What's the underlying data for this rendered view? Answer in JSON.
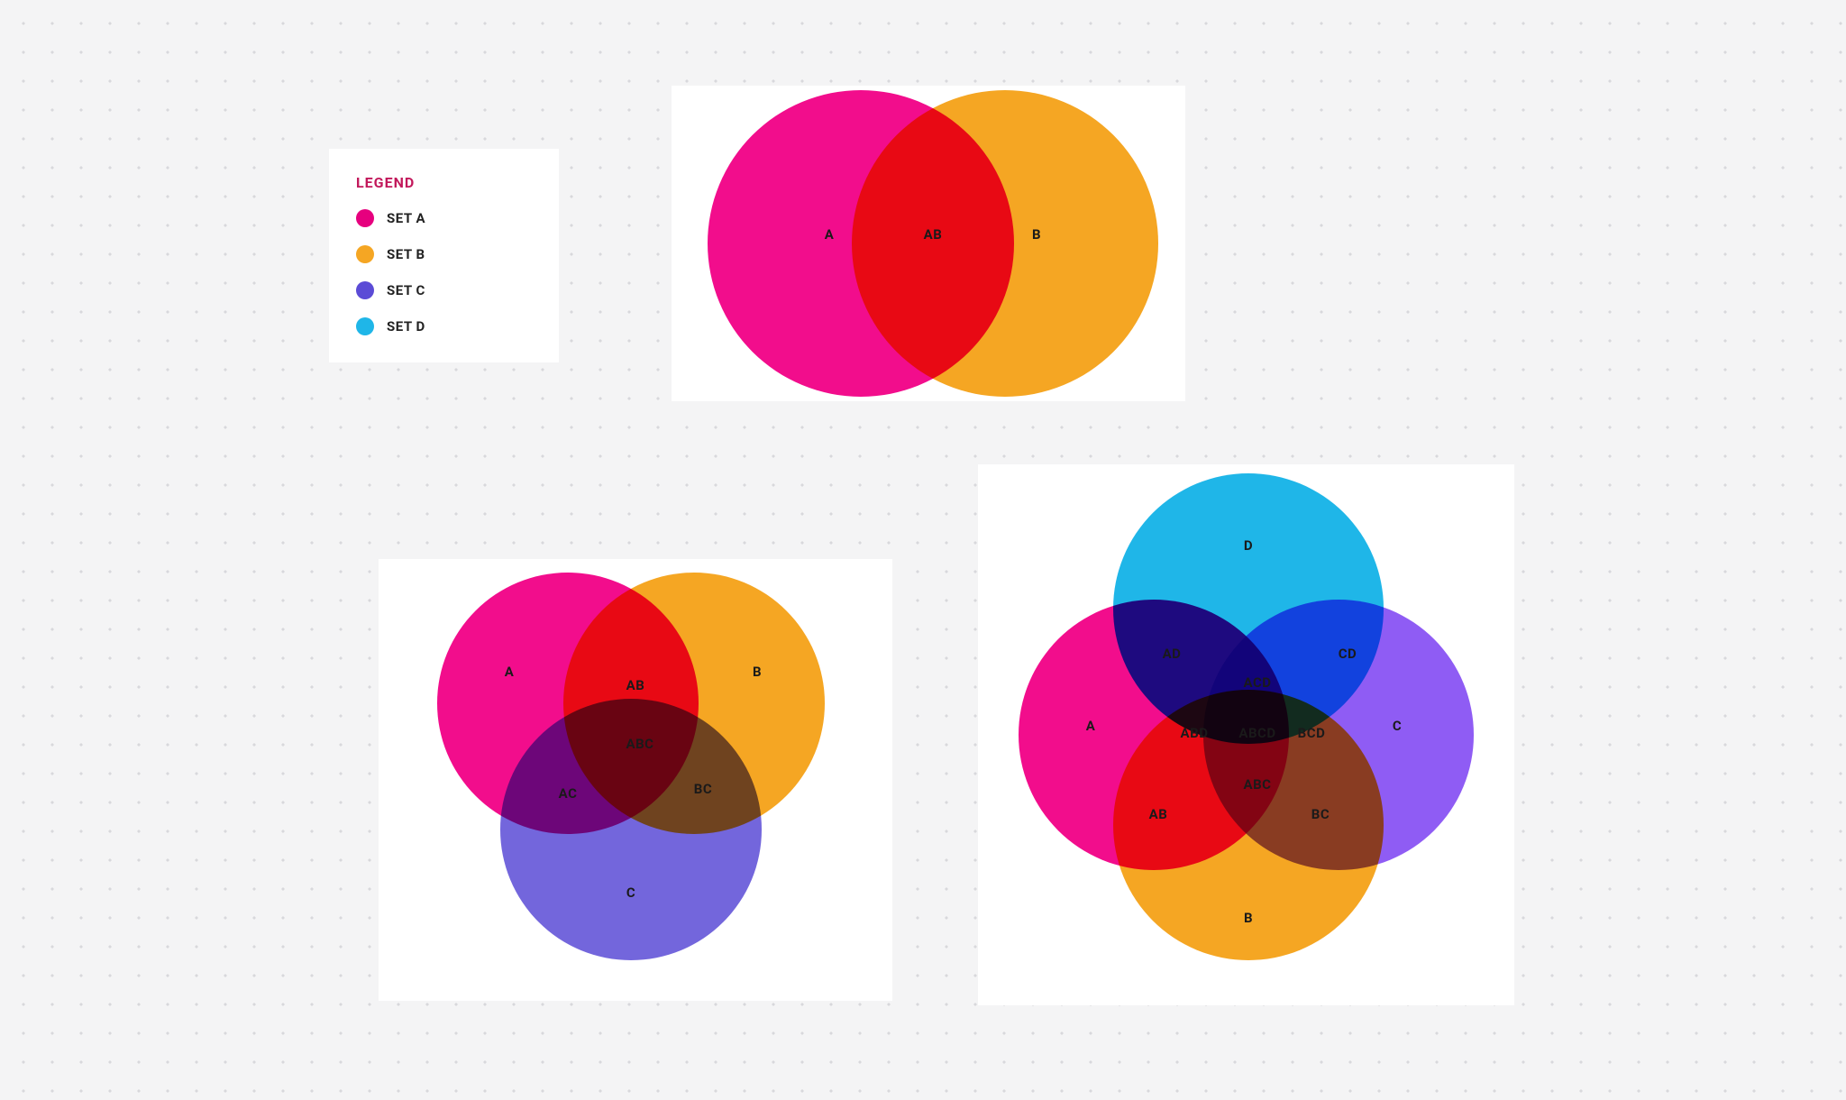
{
  "legend": {
    "title": "LEGEND",
    "items": [
      {
        "label": "SET A",
        "color": "#e6007e"
      },
      {
        "label": "SET B",
        "color": "#f5a623"
      },
      {
        "label": "SET C",
        "color": "#5b4bd6"
      },
      {
        "label": "SET D",
        "color": "#1fb6e8"
      }
    ]
  },
  "colors": {
    "A": "#f20d8c",
    "B": "#f5a623",
    "C": "#5b4bd6",
    "D": "#1fb6e8"
  },
  "chart_data": [
    {
      "type": "venn",
      "sets": [
        "A",
        "B"
      ],
      "regions": [
        "A",
        "AB",
        "B"
      ]
    },
    {
      "type": "venn",
      "sets": [
        "A",
        "B",
        "C"
      ],
      "regions": [
        "A",
        "B",
        "C",
        "AB",
        "AC",
        "BC",
        "ABC"
      ]
    },
    {
      "type": "venn",
      "sets": [
        "A",
        "B",
        "C",
        "D"
      ],
      "regions": [
        "A",
        "B",
        "C",
        "D",
        "AB",
        "AD",
        "BC",
        "CD",
        "ABC",
        "ABD",
        "ACD",
        "BCD",
        "ABCD"
      ]
    }
  ],
  "venn2": {
    "A": "A",
    "AB": "AB",
    "B": "B"
  },
  "venn3": {
    "A": "A",
    "B": "B",
    "C": "C",
    "AB": "AB",
    "AC": "AC",
    "BC": "BC",
    "ABC": "ABC"
  },
  "venn4": {
    "A": "A",
    "B": "B",
    "C": "C",
    "D": "D",
    "AB": "AB",
    "AD": "AD",
    "BC": "BC",
    "CD": "CD",
    "ABC": "ABC",
    "ABD": "ABD",
    "ACD": "ACD",
    "BCD": "BCD",
    "ABCD": "ABCD"
  }
}
